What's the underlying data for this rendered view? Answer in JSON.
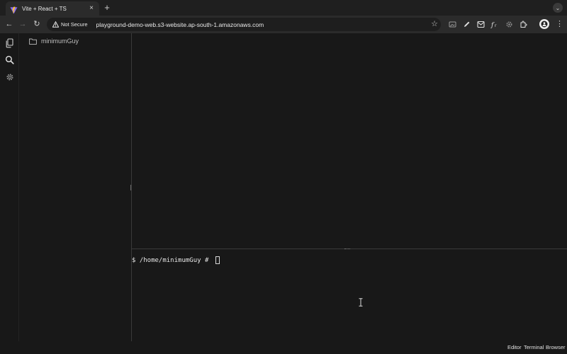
{
  "browser": {
    "tab": {
      "title": "Vite + React + TS",
      "close_glyph": "×",
      "favicon": "vite-icon"
    },
    "new_tab_glyph": "+",
    "tab_list_glyph": "⌄",
    "nav": {
      "back": "←",
      "forward": "→",
      "reload": "↻"
    },
    "omnibox": {
      "security_label": "Not Secure",
      "url": "playground-demo-web.s3-website.ap-south-1.amazonaws.com",
      "star_glyph": "☆"
    },
    "extensions": [
      "screenshot-icon",
      "pen-icon",
      "mail-icon",
      "function-icon",
      "gear-icon",
      "puzzle-icon"
    ],
    "menu_glyph": "⋮"
  },
  "app": {
    "activity_bar": [
      "files-icon",
      "search-icon",
      "settings-icon"
    ],
    "explorer": {
      "folder_name": "minimumGuy"
    },
    "terminal": {
      "prompt": "$ /home/minimumGuy # "
    },
    "status_bar": {
      "links": [
        "Editor",
        "Terminal",
        "Browser"
      ]
    }
  },
  "colors": {
    "background": "#181818",
    "chrome_toolbar": "#2b2b2b",
    "tab_strip": "#1f1f1f",
    "text": "#e8e8e8"
  }
}
